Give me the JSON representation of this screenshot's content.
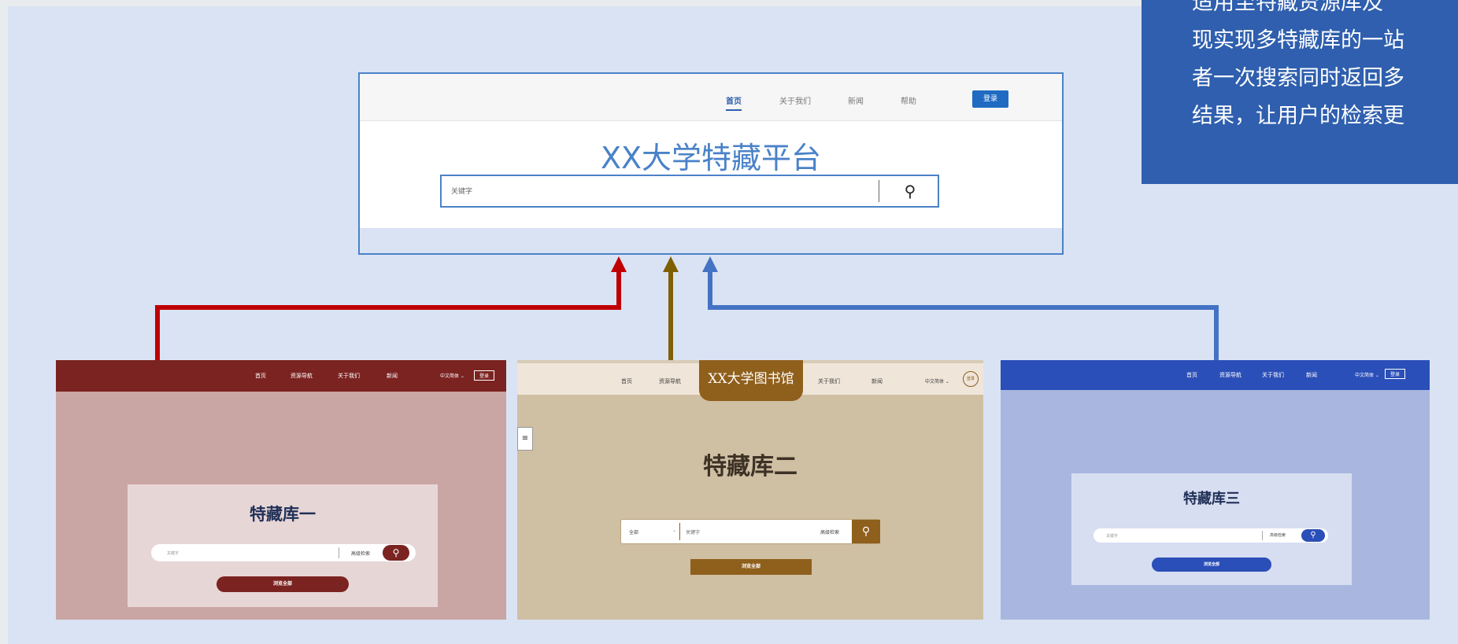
{
  "callout": {
    "lines": [
      "适用至特藏资源库及",
      "现实现多特藏库的一站",
      "者一次搜索同时返回多",
      "结果，让用户的检索更"
    ]
  },
  "platform": {
    "nav": [
      "首页",
      "关于我们",
      "新闻",
      "帮助"
    ],
    "login": "登录",
    "title": "XX大学特藏平台",
    "search_placeholder": "关键字"
  },
  "lib1": {
    "nav": [
      "首页",
      "资源导航",
      "关于我们",
      "新闻"
    ],
    "lang": "中文简体 ⌄",
    "login": "登录",
    "title": "特藏库一",
    "search_placeholder": "关键字",
    "advanced": "高级检索",
    "browse": "浏览全部",
    "color": "#7b2321"
  },
  "lib2": {
    "nav": [
      "首页",
      "资源导航",
      "关于我们",
      "新闻"
    ],
    "logo": "XX大学图书馆",
    "lang": "中文简体 ⌄",
    "user": "登录",
    "menu": "≡",
    "title": "特藏库二",
    "select": "全部",
    "search_placeholder": "关键字",
    "advanced": "高级检索",
    "browse": "浏览全部",
    "color": "#8f5f1c"
  },
  "lib3": {
    "nav": [
      "首页",
      "资源导航",
      "关于我们",
      "新闻"
    ],
    "lang": "中文简体 ⌄",
    "login": "登录",
    "title": "特藏库三",
    "search_placeholder": "关键字",
    "advanced": "高级检索",
    "browse": "浏览全部",
    "color": "#2b4fb8"
  },
  "colors": {
    "canvas": "#dae3f3",
    "callout": "#2f5fae",
    "arrow_red": "#c00000",
    "arrow_brown": "#7f6000",
    "arrow_blue": "#4472c4"
  }
}
